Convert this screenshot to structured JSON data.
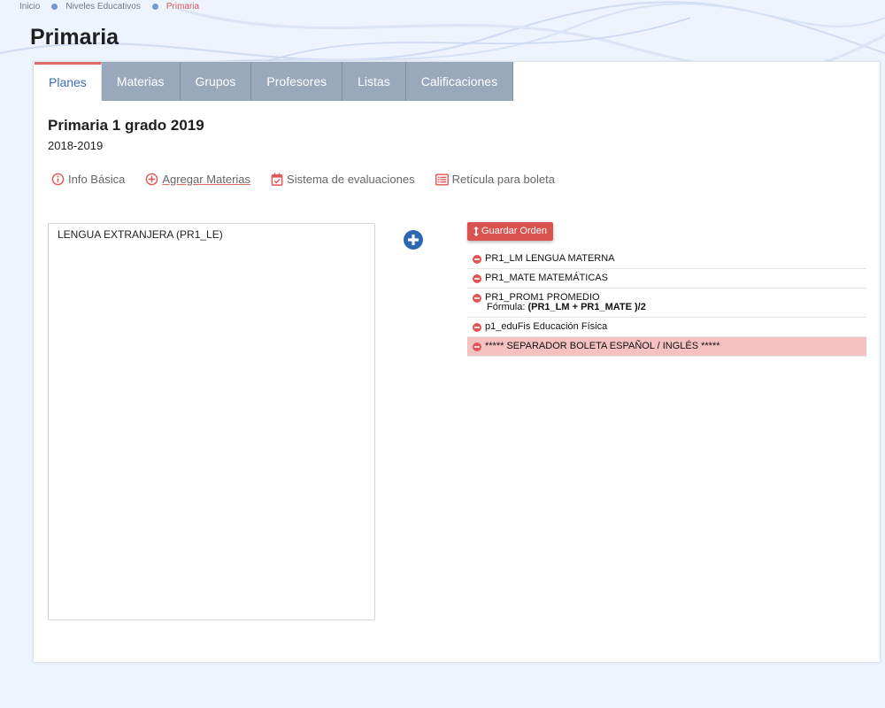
{
  "breadcrumb": {
    "items": [
      "Inicio",
      "Niveles Educativos",
      "Primaria"
    ]
  },
  "page": {
    "title": "Primaria"
  },
  "tabs": [
    {
      "label": "Planes",
      "active": true
    },
    {
      "label": "Materias",
      "active": false
    },
    {
      "label": "Grupos",
      "active": false
    },
    {
      "label": "Profesores",
      "active": false
    },
    {
      "label": "Listas",
      "active": false
    },
    {
      "label": "Calificaciones",
      "active": false
    }
  ],
  "plan": {
    "title": "Primaria 1 grado 2019",
    "years": "2018-2019"
  },
  "actions": {
    "info_basica": "Info Básica",
    "agregar_materias": "Agregar Materias",
    "sistema_evaluaciones": "Sistema de evaluaciones",
    "reticula_boleta": "Retícula para boleta"
  },
  "available_subjects": [
    "LENGUA EXTRANJERA (PR1_LE)"
  ],
  "save_order_label": "Guardar Orden",
  "plan_subjects": [
    {
      "label": "PR1_LM LENGUA MATERNA"
    },
    {
      "label": "PR1_MATE MATEMÁTICAS"
    },
    {
      "label": "PR1_PROM1 PROMEDIO",
      "formula_label": "Fórmula:",
      "formula_value": "(PR1_LM + PR1_MATE )/2"
    },
    {
      "label": "p1_eduFis Educación Física"
    },
    {
      "label": "***** SEPARADOR BOLETA ESPAÑOL / INGLÉS *****",
      "separator": true
    }
  ],
  "colors": {
    "accent_red": "#d9534f",
    "tab_inactive": "#99a8bb",
    "link_blue": "#3a6fb7",
    "separator_bg": "#f5c1c1"
  }
}
